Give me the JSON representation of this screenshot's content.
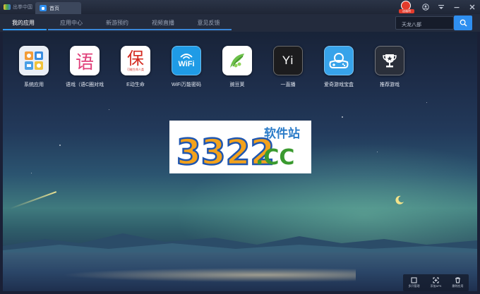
{
  "titlebar": {
    "logo_text": "出拳中国",
    "home_tab": "首页",
    "mascot_badge": "送福利"
  },
  "nav": {
    "tabs": [
      {
        "label": "我的应用",
        "active": true
      },
      {
        "label": "应用中心",
        "active": false
      },
      {
        "label": "新游预约",
        "active": false
      },
      {
        "label": "视频直播",
        "active": false
      },
      {
        "label": "意见反馈",
        "active": false
      }
    ]
  },
  "search": {
    "value": "天龙八部"
  },
  "apps": [
    {
      "label": "系统应用",
      "icon": "system-apps-icon"
    },
    {
      "label": "语戏（语C圈对戏",
      "icon": "yu-icon"
    },
    {
      "label": "E动生命",
      "icon": "bao-icon"
    },
    {
      "label": "WiFi万能密码",
      "icon": "wifi-icon"
    },
    {
      "label": "豌豆荚",
      "icon": "wandoujia-icon"
    },
    {
      "label": "一直播",
      "icon": "yi-icon"
    },
    {
      "label": "爱奇游戏宝盒",
      "icon": "gamepad-icon"
    },
    {
      "label": "推荐游戏",
      "icon": "trophy-icon"
    }
  ],
  "app_icon_text": {
    "yu": "语",
    "bao": "保",
    "bao_sub": "可能生命人类",
    "wifi": "WiFi",
    "yi": "Yi"
  },
  "watermark": {
    "number": "3322",
    "dot_cc": ".CC",
    "site": "软件站"
  },
  "bottom_bar": [
    {
      "label": "多开管理",
      "icon": "multi-instance-icon"
    },
    {
      "label": "添加APK",
      "icon": "add-apk-icon"
    },
    {
      "label": "删除应用",
      "icon": "trash-icon"
    }
  ],
  "colors": {
    "accent": "#2f8ff0",
    "nav_bg": "#232b3d",
    "titlebar_bg": "#2b3447"
  }
}
